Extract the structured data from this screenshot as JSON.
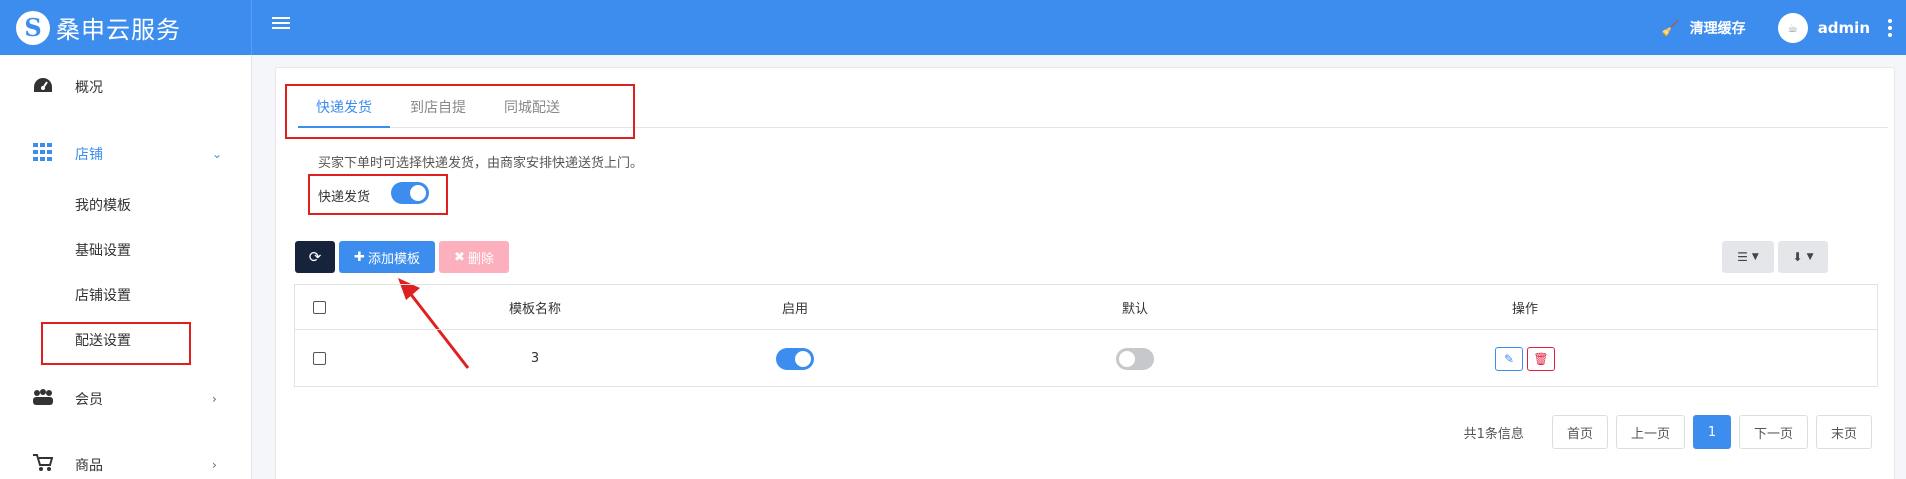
{
  "brand": {
    "logo_glyph": "S",
    "name": "桑申云服务"
  },
  "header": {
    "clear_cache": "清理缓存",
    "username": "admin",
    "avatar_text": "☕"
  },
  "sidebar": {
    "items": [
      {
        "label": "概况",
        "icon": "dashboard-icon"
      },
      {
        "label": "店铺",
        "icon": "grid-icon",
        "active": true
      },
      {
        "label": "会员",
        "icon": "users-icon"
      },
      {
        "label": "商品",
        "icon": "cart-icon"
      }
    ],
    "subitems": [
      "我的模板",
      "基础设置",
      "店铺设置",
      "配送设置"
    ]
  },
  "tabs": [
    "快递发货",
    "到店自提",
    "同城配送"
  ],
  "active_tab": "快递发货",
  "description": "买家下单时可选择快递发货，由商家安排快递送货上门。",
  "toggle": {
    "label": "快递发货",
    "on": true
  },
  "toolbar": {
    "add_label": "添加模板",
    "delete_label": "删除"
  },
  "table": {
    "columns": [
      "模板名称",
      "启用",
      "默认",
      "操作"
    ],
    "rows": [
      {
        "name": "3",
        "enabled": true,
        "default": false
      }
    ]
  },
  "pagination": {
    "info": "共1条信息",
    "first": "首页",
    "prev": "上一页",
    "current": "1",
    "next": "下一页",
    "last": "末页"
  },
  "colors": {
    "primary": "#3c8dee",
    "dark": "#17233b",
    "danger": "#e02040",
    "highlight": "#e02020"
  }
}
